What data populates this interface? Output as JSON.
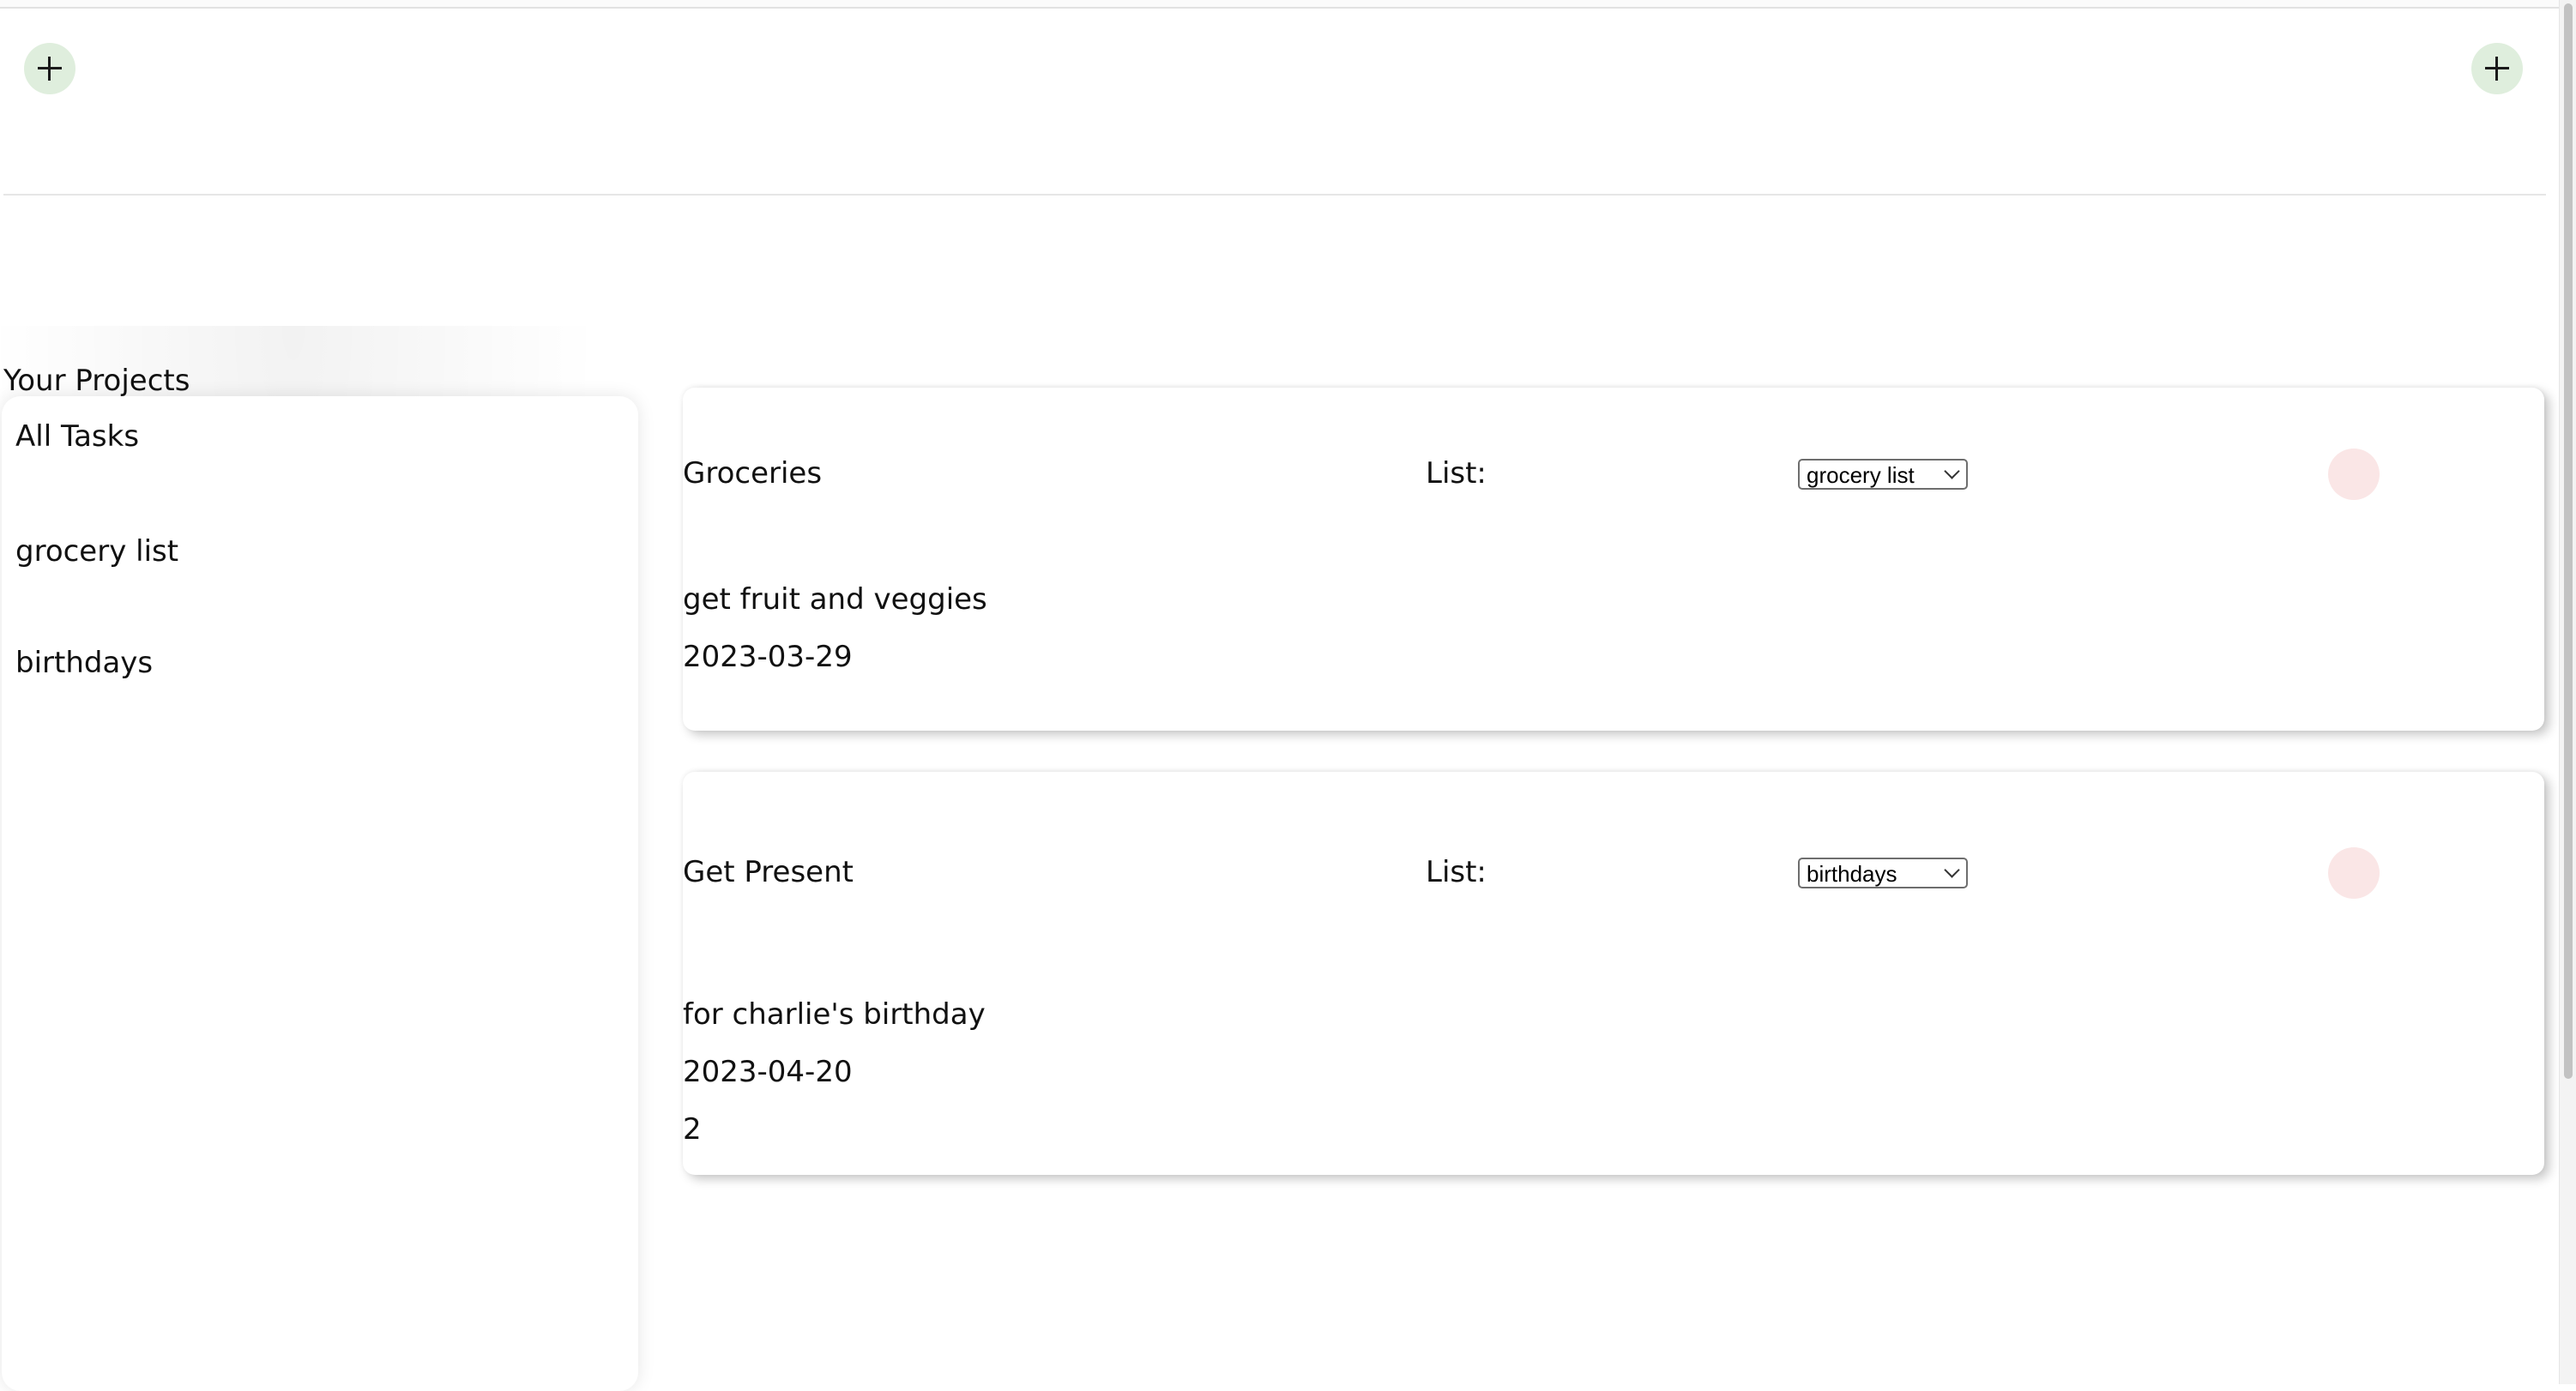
{
  "header": {
    "add_left_label": "+",
    "add_right_label": "+"
  },
  "sidebar": {
    "heading": "Your Projects",
    "items": [
      {
        "label": "All Tasks"
      },
      {
        "label": "grocery list"
      },
      {
        "label": "birthdays"
      }
    ]
  },
  "tasks": [
    {
      "title": "Groceries",
      "list_label": "List:",
      "list_selected": "grocery list",
      "description": "get fruit and veggies",
      "due_date": "2023-03-29",
      "priority": ""
    },
    {
      "title": "Get Present",
      "list_label": "List:",
      "list_selected": "birthdays",
      "description": "for charlie's birthday",
      "due_date": "2023-04-20",
      "priority": "2"
    }
  ],
  "icons": {
    "add": "plus-icon",
    "dropdown": "chevron-down-icon",
    "delete": "delete-circle-icon"
  },
  "colors": {
    "add_button": "#dfeedd",
    "delete_button": "#fae6e6",
    "background": "#ffffff"
  }
}
